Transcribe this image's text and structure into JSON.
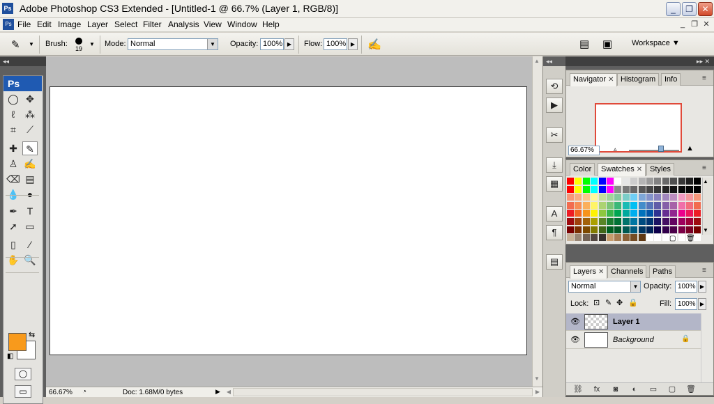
{
  "app": {
    "title": "Adobe Photoshop CS3 Extended - [Untitled-1 @ 66.7% (Layer 1, RGB/8)]",
    "logo_text": "Ps",
    "window_buttons": [
      "_",
      "❐",
      "✕"
    ],
    "mdi_buttons": [
      "_",
      "❐",
      "✕"
    ]
  },
  "menubar": {
    "items": [
      "File",
      "Edit",
      "Image",
      "Layer",
      "Select",
      "Filter",
      "Analysis",
      "View",
      "Window",
      "Help"
    ]
  },
  "options": {
    "brush_label": "Brush:",
    "brush_size": "19",
    "mode_label": "Mode:",
    "mode_value": "Normal",
    "opacity_label": "Opacity:",
    "opacity_value": "100%",
    "flow_label": "Flow:",
    "flow_value": "100%",
    "workspace_label": "Workspace ▼"
  },
  "toolbox": {
    "header": "◂◂",
    "logo": "Ps",
    "tools": [
      [
        "◯",
        "✥"
      ],
      [
        "ℓ",
        "⁂"
      ],
      [
        "⌗",
        "⟋"
      ],
      [
        "✚",
        "✎"
      ],
      [
        "♙",
        "✍"
      ],
      [
        "⌫",
        "▤"
      ],
      [
        "💧",
        "●"
      ],
      [
        "✒",
        "T"
      ],
      [
        "➚",
        "▭"
      ],
      [
        "▯",
        "⁄"
      ],
      [
        "✋",
        "🔍"
      ]
    ],
    "foreground_color": "#f89a1c",
    "background_color": "#ffffff"
  },
  "status": {
    "zoom": "66.67%",
    "doc": "Doc: 1.68M/0 bytes"
  },
  "dock": {
    "header": "◂◂",
    "buttons": [
      "⟲",
      "▶",
      "✂",
      "⤓",
      "▦",
      "A",
      "¶",
      "▤"
    ]
  },
  "panels": {
    "header": "▸▸ ✕",
    "navigator": {
      "tabs": [
        "Navigator",
        "Histogram",
        "Info"
      ],
      "zoom_value": "66.67%",
      "zoom_level": 0.66
    },
    "color": {
      "tabs": [
        "Color",
        "Swatches",
        "Styles"
      ],
      "swatches": [
        [
          "#ff0000",
          "#ffff00",
          "#00ff00",
          "#00ffff",
          "#0000ff",
          "#ff00ff",
          "#ffffff",
          "#e6e6e6",
          "#cdcdcd",
          "#b4b4b4",
          "#9b9b9b",
          "#828282",
          "#696969",
          "#505050",
          "#373737",
          "#1e1e1e",
          "#000000"
        ],
        [
          "#ff0000",
          "#ffff00",
          "#00ff00",
          "#00ffff",
          "#0000ff",
          "#ff00ff",
          "#898989",
          "#787878",
          "#676767",
          "#575757",
          "#464646",
          "#353535",
          "#242424",
          "#131313",
          "#0a0a0a",
          "#050505",
          "#000000"
        ],
        [
          "#f7977a",
          "#f9ad81",
          "#fdc68a",
          "#fff79a",
          "#c4df9b",
          "#a2d39c",
          "#82ca9d",
          "#7bcdc8",
          "#6ecff6",
          "#7ea7d8",
          "#8493ca",
          "#8882be",
          "#a187be",
          "#bc8dbf",
          "#f49ac2",
          "#f6989d",
          "#f7977a"
        ],
        [
          "#f26c4f",
          "#f68e55",
          "#fbaf5c",
          "#fff467",
          "#acd372",
          "#7cc576",
          "#3bb878",
          "#1abbb4",
          "#00bff3",
          "#438cca",
          "#5574b9",
          "#605ca8",
          "#855fa8",
          "#a763a8",
          "#f06ea9",
          "#f26d7d",
          "#f26c4f"
        ],
        [
          "#ed1c24",
          "#f26522",
          "#f7941d",
          "#fff200",
          "#8dc73f",
          "#39b54a",
          "#00a651",
          "#00a99d",
          "#00aeef",
          "#0072bc",
          "#0054a6",
          "#2e3192",
          "#662d91",
          "#92278f",
          "#ec008c",
          "#ed145b",
          "#ed1c24"
        ],
        [
          "#9e0b0f",
          "#a0410d",
          "#a36209",
          "#aba000",
          "#598527",
          "#1a7b30",
          "#007236",
          "#00746b",
          "#0076a3",
          "#004b80",
          "#003471",
          "#1b1464",
          "#440e62",
          "#630460",
          "#9e005d",
          "#9e0039",
          "#9e0b0f"
        ],
        [
          "#790000",
          "#7b2e00",
          "#7d4900",
          "#827b00",
          "#406618",
          "#005e20",
          "#005826",
          "#005952",
          "#005b7f",
          "#003663",
          "#002157",
          "#0d004c",
          "#32004b",
          "#4b0049",
          "#7b0046",
          "#7a0026",
          "#790000"
        ],
        [
          "#c7b299",
          "#998675",
          "#736357",
          "#534741",
          "#37302d",
          "#c69c6d",
          "#a67c52",
          "#8c6239",
          "#754c24",
          "#603913",
          "#ffffff",
          "#ffffff",
          "#ffffff",
          "#ffffff",
          "#ffffff",
          "#ffffff",
          "#ffffff"
        ]
      ]
    },
    "layers": {
      "tabs": [
        "Layers",
        "Channels",
        "Paths"
      ],
      "blend_mode": "Normal",
      "opacity_label": "Opacity:",
      "opacity_value": "100%",
      "lock_label": "Lock:",
      "fill_label": "Fill:",
      "fill_value": "100%",
      "items": [
        {
          "name": "Layer 1",
          "selected": true
        },
        {
          "name": "Background",
          "selected": false
        }
      ],
      "footer_icons": [
        "⛓",
        "fx",
        "◙",
        "◐",
        "▭",
        "▢",
        "🗑"
      ]
    }
  }
}
